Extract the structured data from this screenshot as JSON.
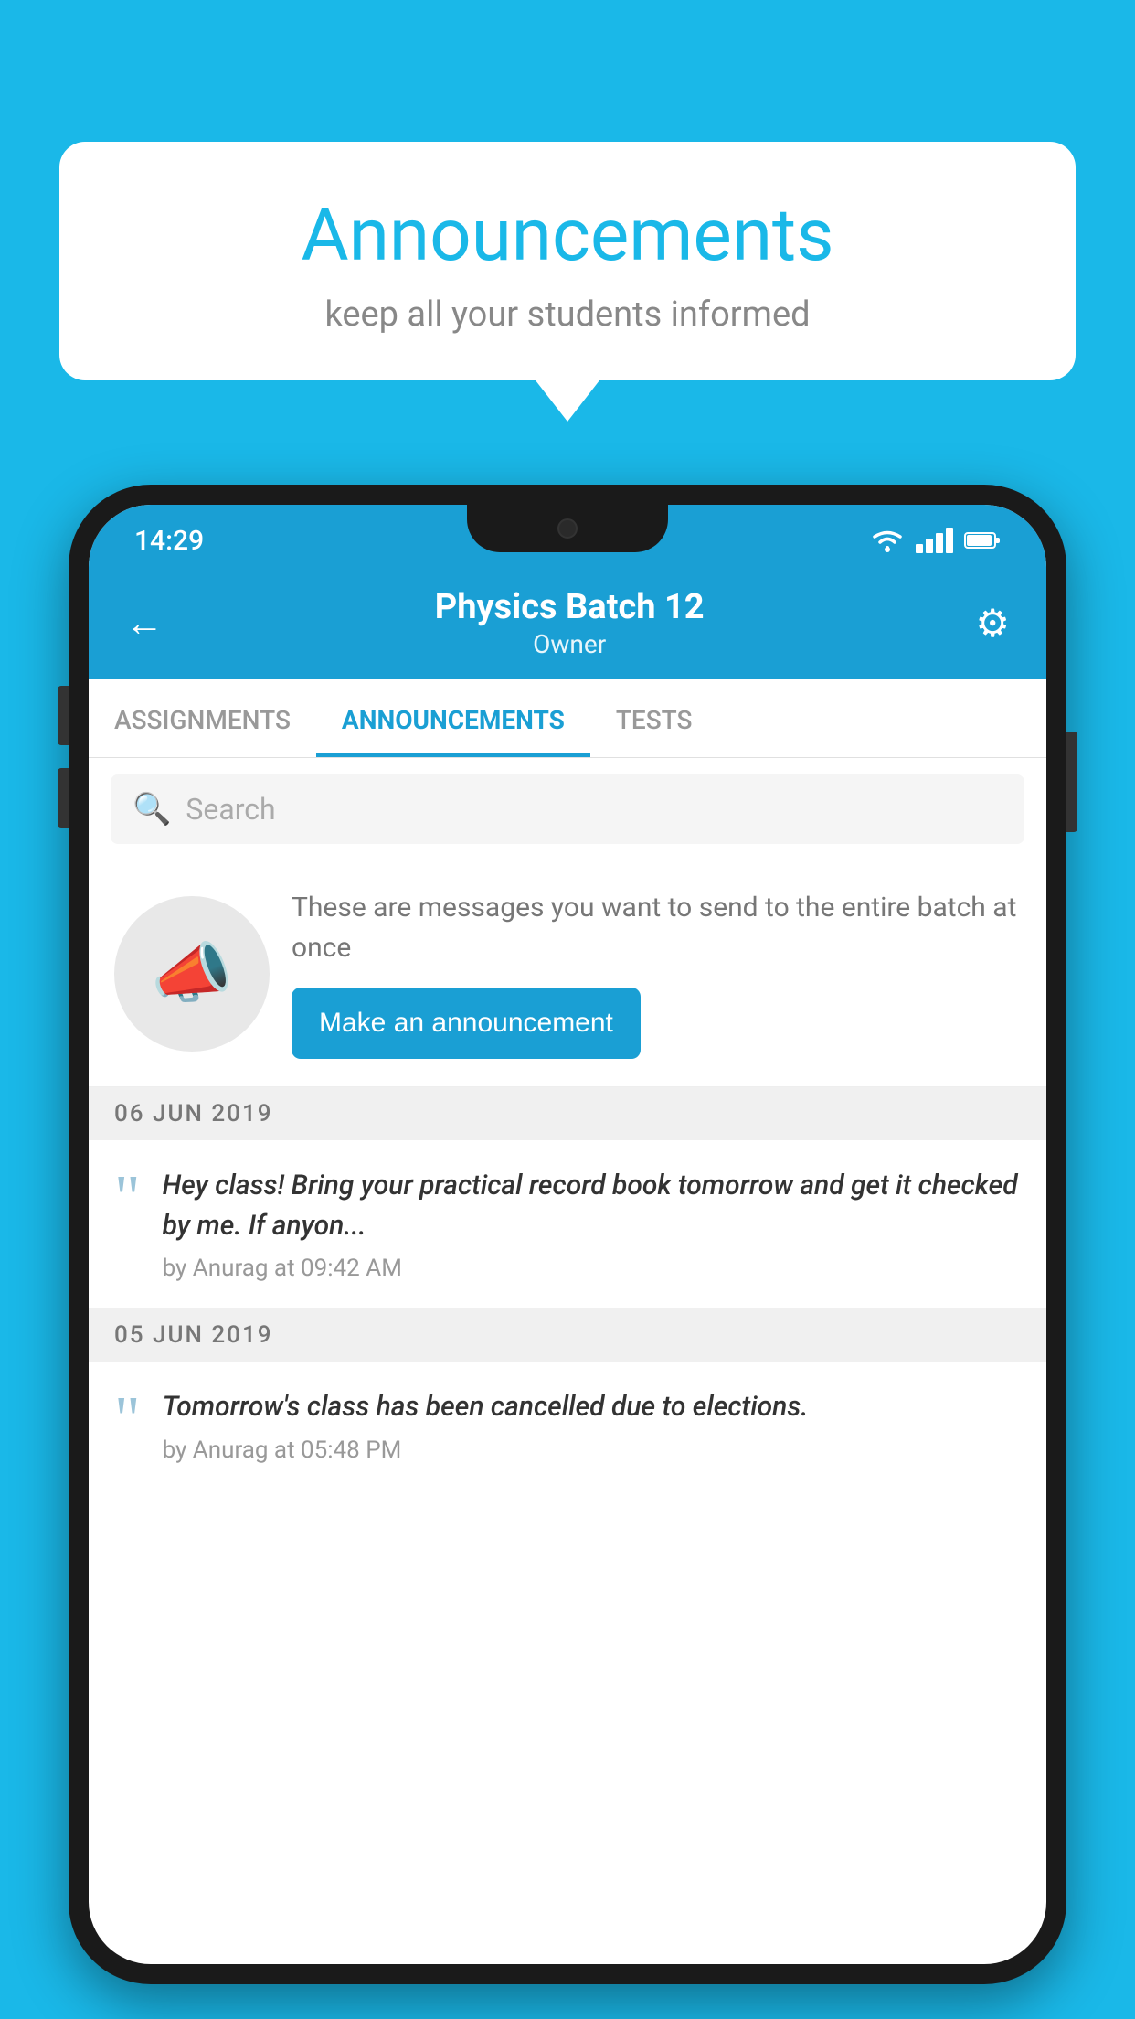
{
  "background_color": "#1ab8e8",
  "speech_bubble": {
    "title": "Announcements",
    "subtitle": "keep all your students informed"
  },
  "phone": {
    "status_bar": {
      "time": "14:29"
    },
    "header": {
      "title": "Physics Batch 12",
      "subtitle": "Owner",
      "back_label": "←",
      "gear_label": "⚙"
    },
    "tabs": [
      {
        "label": "ASSIGNMENTS",
        "active": false
      },
      {
        "label": "ANNOUNCEMENTS",
        "active": true
      },
      {
        "label": "TESTS",
        "active": false
      }
    ],
    "search": {
      "placeholder": "Search"
    },
    "promo": {
      "description": "These are messages you want to send to the entire batch at once",
      "button_label": "Make an announcement"
    },
    "announcements": [
      {
        "date": "06  JUN  2019",
        "text": "Hey class! Bring your practical record book tomorrow and get it checked by me. If anyon...",
        "meta": "by Anurag at 09:42 AM"
      },
      {
        "date": "05  JUN  2019",
        "text": "Tomorrow's class has been cancelled due to elections.",
        "meta": "by Anurag at 05:48 PM"
      }
    ]
  }
}
